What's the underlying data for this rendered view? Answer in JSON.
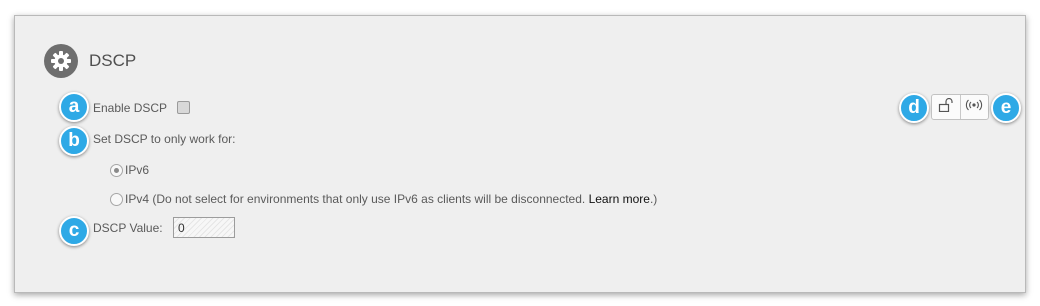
{
  "section": {
    "title": "DSCP",
    "icon": "gear-icon"
  },
  "badges": {
    "a": "a",
    "b": "b",
    "c": "c",
    "d": "d",
    "e": "e"
  },
  "enable": {
    "label": "Enable DSCP",
    "checked": false
  },
  "restrict": {
    "label": "Set DSCP to only work for:",
    "options": [
      {
        "label": "IPv6",
        "selected": true
      },
      {
        "label": "IPv4 (Do not select for environments that only use IPv6 as clients will be disconnected. ",
        "link": "Learn more",
        "suffix": ".)",
        "selected": false
      }
    ]
  },
  "dscp_value": {
    "label": "DSCP Value:",
    "value": "0"
  },
  "toolbar": {
    "icons": [
      "unlock-icon",
      "broadcast-icon"
    ]
  },
  "colors": {
    "accent": "#2ea9e6",
    "panel": "#efefef",
    "gear": "#6e6e6e"
  }
}
